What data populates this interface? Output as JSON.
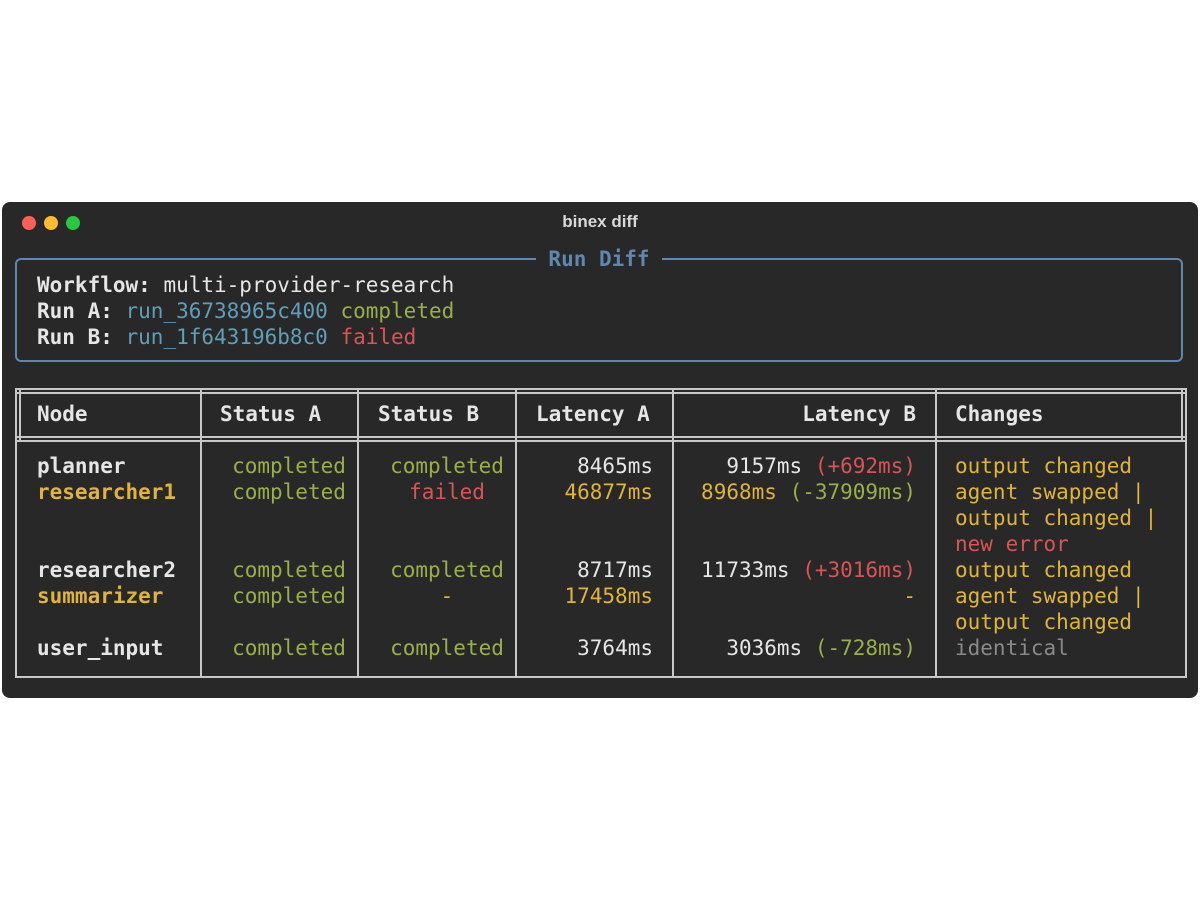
{
  "window": {
    "title": "binex diff"
  },
  "panel": {
    "title": "Run Diff",
    "workflow_label": "Workflow:",
    "workflow_value": "multi-provider-research",
    "run_a_label": "Run A:",
    "run_a_id": "run_36738965c400",
    "run_a_status": "completed",
    "run_b_label": "Run B:",
    "run_b_id": "run_1f643196b8c0",
    "run_b_status": "failed"
  },
  "table": {
    "headers": {
      "node": "Node",
      "status_a": "Status A",
      "status_b": "Status B",
      "latency_a": "Latency A",
      "latency_b": "Latency B",
      "changes": "Changes"
    },
    "rows": [
      {
        "node": "planner",
        "status_a": "completed",
        "status_b": "completed",
        "latency_a": "8465ms",
        "latency_b": "9157ms",
        "latency_delta": "(+692ms)",
        "changes": [
          "output changed"
        ]
      },
      {
        "node": "researcher1",
        "status_a": "completed",
        "status_b": "failed",
        "latency_a": "46877ms",
        "latency_b": "8968ms",
        "latency_delta": "(-37909ms)",
        "changes": [
          "agent swapped |",
          "output changed |",
          "new error"
        ]
      },
      {
        "node": "researcher2",
        "status_a": "completed",
        "status_b": "completed",
        "latency_a": "8717ms",
        "latency_b": "11733ms",
        "latency_delta": "(+3016ms)",
        "changes": [
          "output changed"
        ]
      },
      {
        "node": "summarizer",
        "status_a": "completed",
        "status_b": "-",
        "latency_a": "17458ms",
        "latency_b": "-",
        "latency_delta": "",
        "changes": [
          "agent swapped |",
          "output changed"
        ]
      },
      {
        "node": "user_input",
        "status_a": "completed",
        "status_b": "completed",
        "latency_a": "3764ms",
        "latency_b": "3036ms",
        "latency_delta": "(-728ms)",
        "changes": [
          "identical"
        ]
      }
    ]
  },
  "colors": {
    "background": "#282828",
    "border_panel": "#5f87af",
    "border_table": "#c8c8c8",
    "cyan": "#5f9fb8",
    "green": "#98b04a",
    "red": "#d95555",
    "yellow": "#e0b43a",
    "white": "#e6e6e6",
    "gray": "#8a8a8a"
  }
}
